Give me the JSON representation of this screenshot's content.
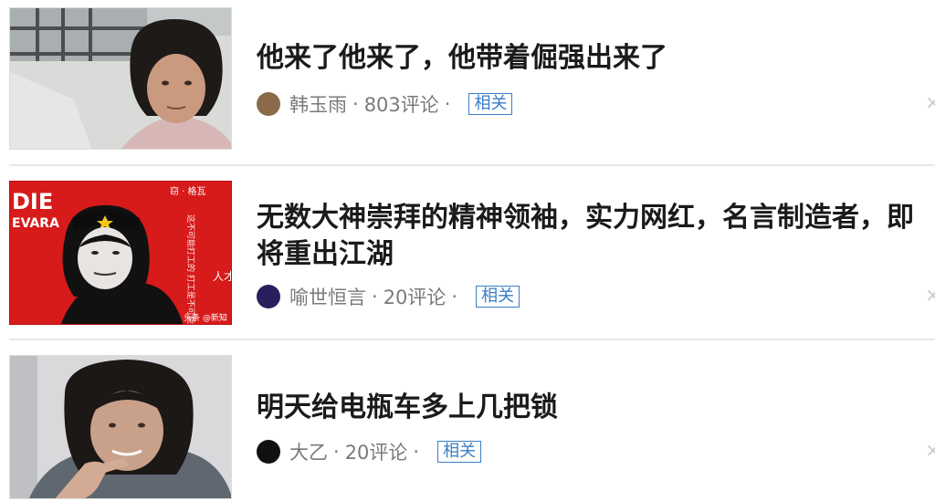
{
  "feed": {
    "items": [
      {
        "title": "他来了他来了，他带着倔强出来了",
        "author": "韩玉雨",
        "comments": "803评论",
        "tag": "相关",
        "dislike": "×",
        "avatar_color": "#8a6a4a"
      },
      {
        "title_line1": "无数大神崇拜的精神领袖，实力网红，名言制造者，即",
        "title_line2": "将重出江湖",
        "author": "喻世恒言",
        "comments": "20评论",
        "tag": "相关",
        "dislike": "×",
        "avatar_color": "#2a1f5c",
        "poster": {
          "che_top": "DIE",
          "che_bottom": "EVARA",
          "side_title": "窃 · 格瓦",
          "side_text": "这不可能打工的 打工是不可能打工的",
          "corner_mark": "人才",
          "footer": "头条 @新知"
        }
      },
      {
        "title": "明天给电瓶车多上几把锁",
        "author": "大乙",
        "comments": "20评论",
        "tag": "相关",
        "dislike": "×",
        "avatar_color": "#111111"
      }
    ],
    "separator": "·"
  }
}
